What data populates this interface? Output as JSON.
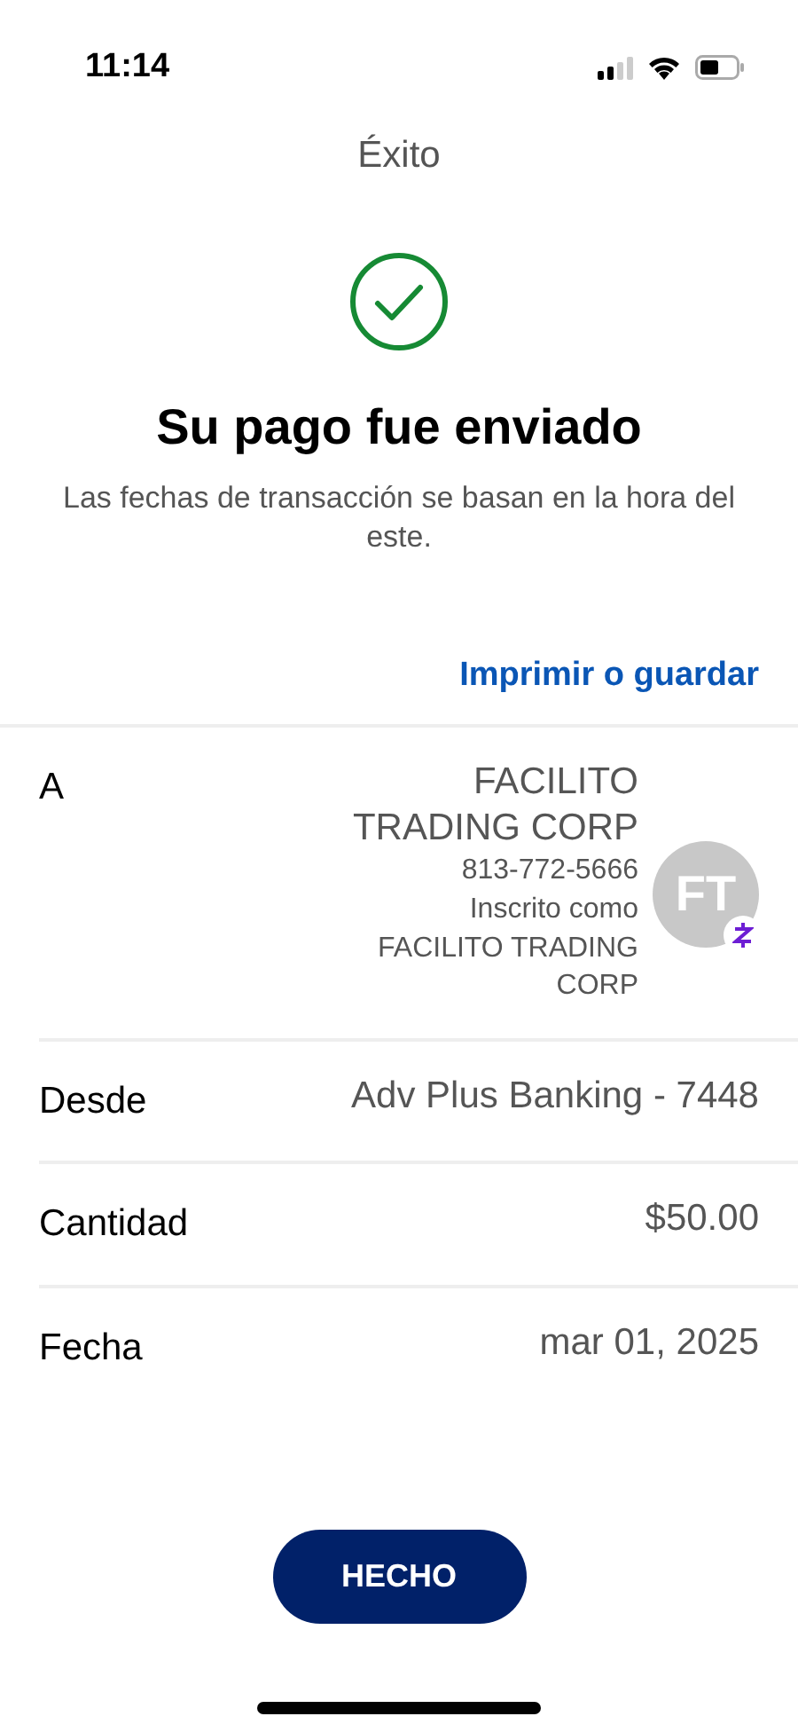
{
  "status_bar": {
    "time": "11:14"
  },
  "header": {
    "title": "Éxito"
  },
  "confirmation": {
    "heading": "Su pago fue enviado",
    "note": "Las fechas de transacción se basan en la hora del este."
  },
  "print_link": "Imprimir o guardar",
  "details": [
    {
      "kind": "recipient",
      "label": "A",
      "name": "FACILITO TRADING CORP",
      "phone": "813-772-5666",
      "enrolled": "Inscrito como FACILITO TRADING CORP",
      "initials": "FT"
    },
    {
      "kind": "plain",
      "label": "Desde",
      "value": "Adv Plus Banking - 7448"
    },
    {
      "kind": "plain",
      "label": "Cantidad",
      "value": "$50.00"
    },
    {
      "kind": "plain",
      "label": "Fecha",
      "value": "mar 01, 2025"
    }
  ],
  "done_button": "HECHO"
}
